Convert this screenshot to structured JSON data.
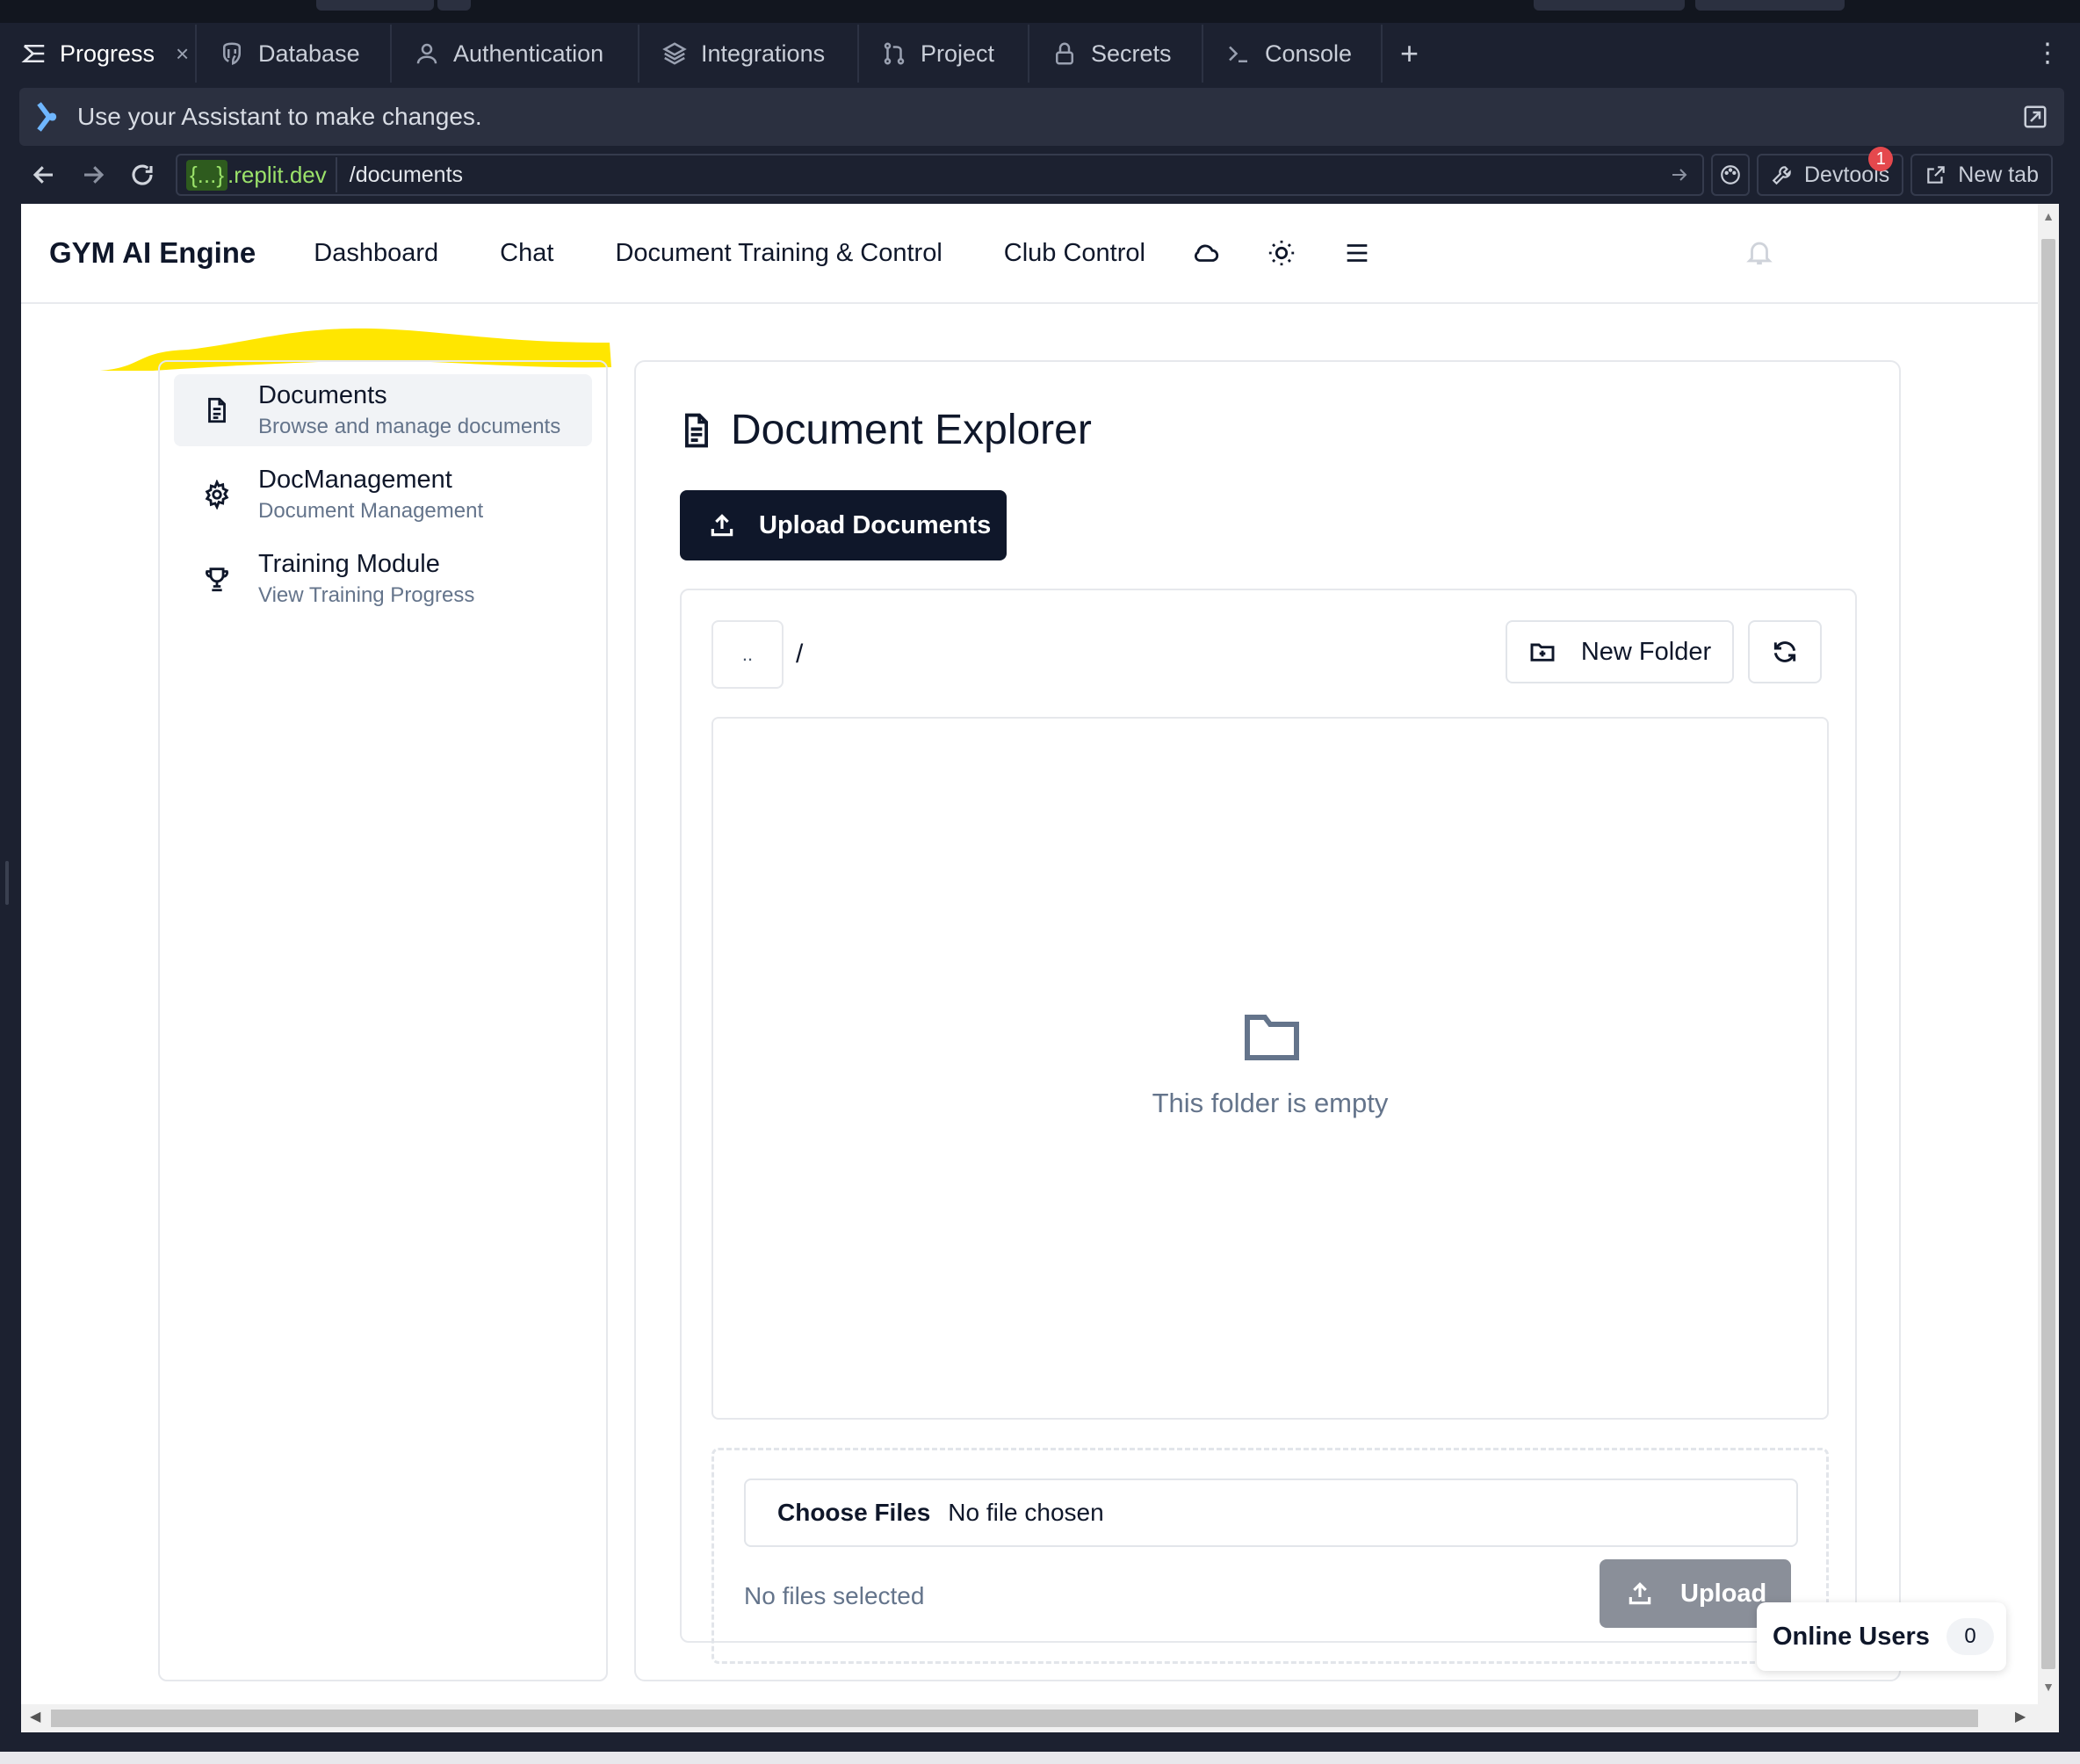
{
  "ide": {
    "tabs": [
      {
        "label": "Progress",
        "icon": "progress-icon",
        "active": true,
        "closable": true
      },
      {
        "label": "Database",
        "icon": "database-icon"
      },
      {
        "label": "Authentication",
        "icon": "user-icon"
      },
      {
        "label": "Integrations",
        "icon": "layers-icon"
      },
      {
        "label": "Project",
        "icon": "git-icon"
      },
      {
        "label": "Secrets",
        "icon": "lock-icon"
      },
      {
        "label": "Console",
        "icon": "terminal-icon"
      }
    ],
    "add_tab": "+",
    "menu": "⋮",
    "close_glyph": "×",
    "assistant_prompt": "Use your Assistant to make changes.",
    "url": {
      "host_braces": "{...}",
      "host_domain": ".replit.dev",
      "path": "/documents"
    },
    "devtools_label": "Devtools",
    "devtools_badge": "1",
    "newtab_label": "New tab"
  },
  "app": {
    "brand": "GYM AI Engine",
    "nav": [
      "Dashboard",
      "Chat",
      "Document Training & Control",
      "Club Control"
    ],
    "sidebar": [
      {
        "title": "Documents",
        "subtitle": "Browse and manage documents",
        "icon": "document-icon",
        "active": true
      },
      {
        "title": "DocManagement",
        "subtitle": "Document Management",
        "icon": "gear-icon"
      },
      {
        "title": "Training Module",
        "subtitle": "View Training Progress",
        "icon": "trophy-icon"
      }
    ],
    "main": {
      "title": "Document Explorer",
      "upload_documents": "Upload Documents",
      "updir": "..",
      "breadcrumb": "/",
      "new_folder": "New Folder",
      "empty_text": "This folder is empty",
      "choose_files": "Choose Files",
      "no_file_chosen": "No file chosen",
      "no_files_selected": "No files selected",
      "upload": "Upload"
    },
    "online_users": {
      "label": "Online Users",
      "count": "0"
    }
  },
  "colors": {
    "primary_dark": "#0f172a",
    "muted_text": "#64748b",
    "highlight": "#ffe600",
    "ide_bg": "#1c2130",
    "badge": "#e5484d",
    "host_green": "#9be26a"
  }
}
